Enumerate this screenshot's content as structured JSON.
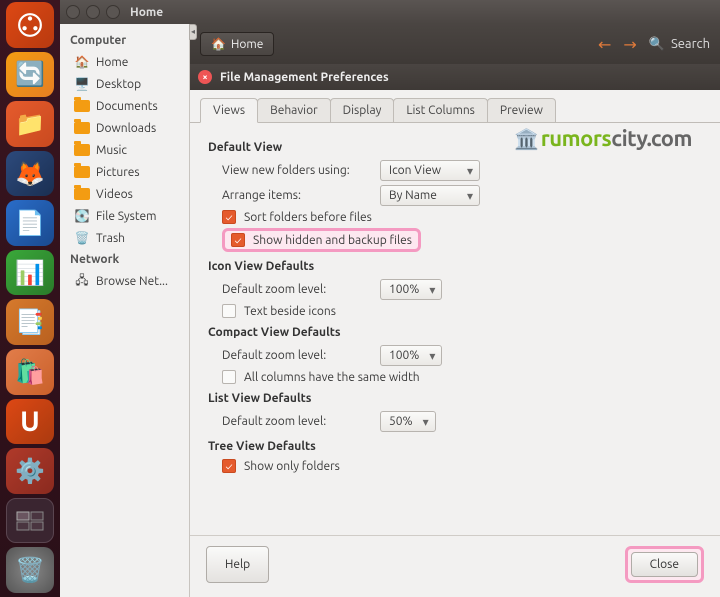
{
  "window": {
    "title": "Home"
  },
  "toolbar": {
    "path": "Home",
    "search": "Search"
  },
  "sidebar": {
    "computer_header": "Computer",
    "network_header": "Network",
    "items": {
      "home": "Home",
      "desktop": "Desktop",
      "documents": "Documents",
      "downloads": "Downloads",
      "music": "Music",
      "pictures": "Pictures",
      "videos": "Videos",
      "filesystem": "File System",
      "trash": "Trash",
      "browse_net": "Browse Net..."
    }
  },
  "dialog": {
    "title": "File Management Preferences",
    "tabs": {
      "views": "Views",
      "behavior": "Behavior",
      "display": "Display",
      "list_columns": "List Columns",
      "preview": "Preview"
    },
    "sections": {
      "default_view": "Default View",
      "icon_view_defaults": "Icon View Defaults",
      "compact_view_defaults": "Compact View Defaults",
      "list_view_defaults": "List View Defaults",
      "tree_view_defaults": "Tree View Defaults"
    },
    "labels": {
      "view_new_folders": "View new folders using:",
      "arrange_items": "Arrange items:",
      "sort_folders": "Sort folders before files",
      "show_hidden": "Show hidden and backup files",
      "default_zoom": "Default zoom level:",
      "text_beside": "Text beside icons",
      "all_columns": "All columns have the same width",
      "show_only_folders": "Show only folders"
    },
    "values": {
      "view_new_folders": "Icon View",
      "arrange_items": "By Name",
      "zoom_icon": "100%",
      "zoom_compact": "100%",
      "zoom_list": "50%"
    },
    "buttons": {
      "help": "Help",
      "close": "Close"
    }
  },
  "watermark": {
    "brand": "rumors",
    "suffix": "city",
    "tld": ".com"
  }
}
